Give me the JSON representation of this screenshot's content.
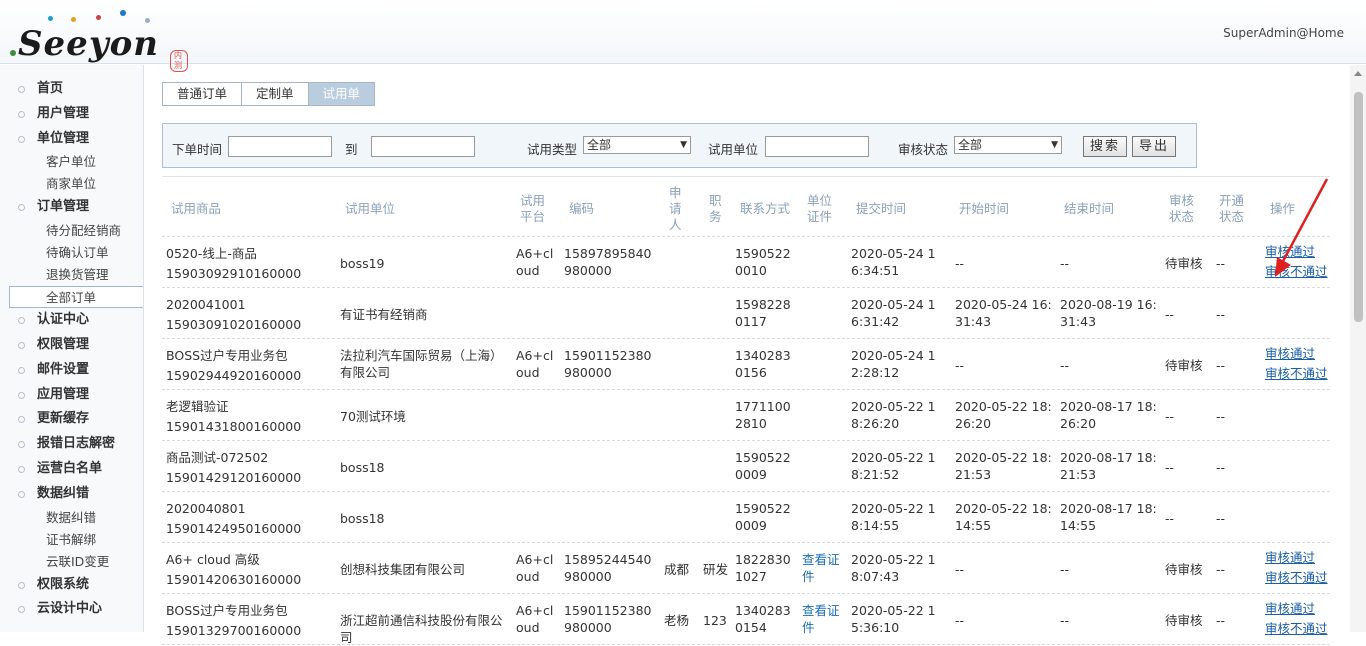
{
  "header": {
    "logo_text": "Seeyon",
    "logo_badge": "内测",
    "user": "SuperAdmin@Home"
  },
  "sidebar": {
    "items": [
      {
        "label": "首页",
        "type": "top"
      },
      {
        "label": "用户管理",
        "type": "top"
      },
      {
        "label": "单位管理",
        "type": "top"
      },
      {
        "label": "客户单位",
        "type": "sub"
      },
      {
        "label": "商家单位",
        "type": "sub"
      },
      {
        "label": "订单管理",
        "type": "top"
      },
      {
        "label": "待分配经销商",
        "type": "sub"
      },
      {
        "label": "待确认订单",
        "type": "sub"
      },
      {
        "label": "退换货管理",
        "type": "sub"
      },
      {
        "label": "全部订单",
        "type": "sub",
        "active": true
      },
      {
        "label": "认证中心",
        "type": "top"
      },
      {
        "label": "权限管理",
        "type": "top"
      },
      {
        "label": "邮件设置",
        "type": "top"
      },
      {
        "label": "应用管理",
        "type": "top"
      },
      {
        "label": "更新缓存",
        "type": "top"
      },
      {
        "label": "报错日志解密",
        "type": "top"
      },
      {
        "label": "运营白名单",
        "type": "top"
      },
      {
        "label": "数据纠错",
        "type": "top"
      },
      {
        "label": "数据纠错",
        "type": "sub"
      },
      {
        "label": "证书解绑",
        "type": "sub"
      },
      {
        "label": "云联ID变更",
        "type": "sub"
      },
      {
        "label": "权限系统",
        "type": "top"
      },
      {
        "label": "云设计中心",
        "type": "top"
      }
    ]
  },
  "tabs": [
    "普通订单",
    "定制单",
    "试用单"
  ],
  "active_tab": "试用单",
  "filter": {
    "order_time_label": "下单时间",
    "to_label": "到",
    "trial_type_label": "试用类型",
    "trial_type_value": "全部",
    "trial_unit_label": "试用单位",
    "audit_status_label": "审核状态",
    "audit_status_value": "全部",
    "search_button": "搜索",
    "export_button": "导出"
  },
  "table": {
    "headers": [
      "试用商品",
      "试用单位",
      "试用平台",
      "编码",
      "申请人",
      "职务",
      "联系方式",
      "单位证件",
      "提交时间",
      "开始时间",
      "结束时间",
      "审核状态",
      "开通状态",
      "操作"
    ],
    "rows": [
      {
        "product": "0520-线上-商品",
        "product_id": "15903092910160000",
        "unit": "boss19",
        "platform": "A6+cloud",
        "code": "15897895840980000",
        "applicant": "",
        "position": "",
        "contact": "15905220010",
        "cert": "",
        "submit": "2020-05-24 16:34:51",
        "start": "--",
        "end": "--",
        "audit": "待审核",
        "open": "--",
        "approve": "审核通过",
        "reject": "审核不通过"
      },
      {
        "product": "2020041001",
        "product_id": "15903091020160000",
        "unit": "有证书有经销商",
        "platform": "",
        "code": "",
        "applicant": "",
        "position": "",
        "contact": "15982280117",
        "cert": "",
        "submit": "2020-05-24 16:31:42",
        "start": "2020-05-24 16:31:43",
        "end": "2020-08-19 16:31:43",
        "audit": "--",
        "open": "--",
        "approve": "",
        "reject": ""
      },
      {
        "product": "BOSS过户专用业务包",
        "product_id": "15902944920160000",
        "unit": "法拉利汽车国际贸易（上海）有限公司",
        "platform": "A6+cloud",
        "code": "15901152380980000",
        "applicant": "",
        "position": "",
        "contact": "13402830156",
        "cert": "",
        "submit": "2020-05-24 12:28:12",
        "start": "--",
        "end": "--",
        "audit": "待审核",
        "open": "--",
        "approve": "审核通过",
        "reject": "审核不通过"
      },
      {
        "product": "老逻辑验证",
        "product_id": "15901431800160000",
        "unit": "70测试环境",
        "platform": "",
        "code": "",
        "applicant": "",
        "position": "",
        "contact": "17711002810",
        "cert": "",
        "submit": "2020-05-22 18:26:20",
        "start": "2020-05-22 18:26:20",
        "end": "2020-08-17 18:26:20",
        "audit": "--",
        "open": "--",
        "approve": "",
        "reject": ""
      },
      {
        "product": "商品测试-072502",
        "product_id": "15901429120160000",
        "unit": "boss18",
        "platform": "",
        "code": "",
        "applicant": "",
        "position": "",
        "contact": "15905220009",
        "cert": "",
        "submit": "2020-05-22 18:21:52",
        "start": "2020-05-22 18:21:53",
        "end": "2020-08-17 18:21:53",
        "audit": "--",
        "open": "--",
        "approve": "",
        "reject": ""
      },
      {
        "product": "2020040801",
        "product_id": "15901424950160000",
        "unit": "boss18",
        "platform": "",
        "code": "",
        "applicant": "",
        "position": "",
        "contact": "15905220009",
        "cert": "",
        "submit": "2020-05-22 18:14:55",
        "start": "2020-05-22 18:14:55",
        "end": "2020-08-17 18:14:55",
        "audit": "--",
        "open": "--",
        "approve": "",
        "reject": ""
      },
      {
        "product": "A6+ cloud 高级",
        "product_id": "15901420630160000",
        "unit": "创想科技集团有限公司",
        "platform": "A6+cloud",
        "code": "15895244540980000",
        "applicant": "成都",
        "position": "研发",
        "contact": "18228301027",
        "cert": "查看证件",
        "submit": "2020-05-22 18:07:43",
        "start": "--",
        "end": "--",
        "audit": "待审核",
        "open": "--",
        "approve": "审核通过",
        "reject": "审核不通过"
      },
      {
        "product": "BOSS过户专用业务包",
        "product_id": "15901329700160000",
        "unit": "浙江超前通信科技股份有限公司",
        "platform": "A6+cloud",
        "code": "15901152380980000",
        "applicant": "老杨",
        "position": "123",
        "contact": "13402830154",
        "cert": "查看证件",
        "submit": "2020-05-22 15:36:10",
        "start": "--",
        "end": "--",
        "audit": "待审核",
        "open": "--",
        "approve": "审核通过",
        "reject": "审核不通过"
      }
    ]
  },
  "colors": {
    "accent_link": "#1a5ea8",
    "header_text": "#8aa2b8",
    "annotation_arrow": "#e02020"
  }
}
